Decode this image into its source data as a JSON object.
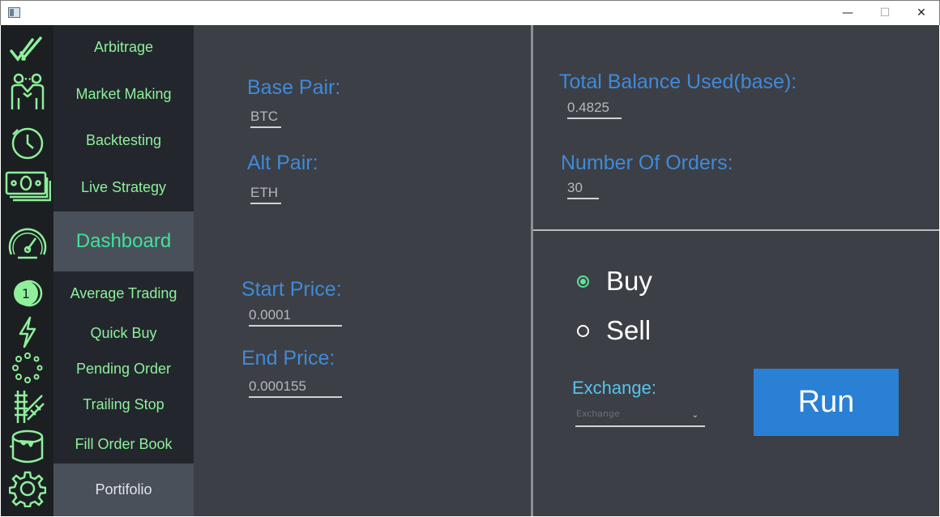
{
  "window": {
    "minimize_glyph": "—",
    "maximize_glyph": "☐",
    "close_glyph": "✕"
  },
  "icon_sidebar": {
    "icons": [
      "checkmark-icon",
      "handshake-icon",
      "clock-icon",
      "money-icon",
      "speedometer-icon",
      "coin-icon",
      "lightning-icon",
      "loading-dots-icon",
      "railway-icon",
      "paint-bucket-icon",
      "gear-icon"
    ],
    "coin_number": "1",
    "accent_color": "#8ef09b"
  },
  "menu": {
    "items": [
      "Arbitrage",
      "Market Making",
      "Backtesting",
      "Live Strategy"
    ],
    "active": "Dashboard",
    "sub_items": [
      "Average Trading",
      "Quick Buy",
      "Pending Order",
      "Trailing Stop",
      "Fill Order Book"
    ],
    "footer": "Portifolio"
  },
  "form": {
    "base_pair_label": "Base Pair:",
    "base_pair_value": "BTC",
    "alt_pair_label": "Alt Pair:",
    "alt_pair_value": "ETH",
    "start_price_label": "Start Price:",
    "start_price_value": "0.0001",
    "end_price_label": "End Price:",
    "end_price_value": "0.000155",
    "total_balance_label": "Total Balance Used(base):",
    "total_balance_value": "0.4825",
    "orders_label": "Number Of Orders:",
    "orders_value": "30"
  },
  "side": {
    "buy_label": "Buy",
    "sell_label": "Sell",
    "selected": "Buy"
  },
  "exchange": {
    "label": "Exchange:",
    "placeholder": "Exchange"
  },
  "run_label": "Run",
  "colors": {
    "label_blue": "#3f8ad9",
    "run_button": "#2a80d5",
    "background": "#3c3f45",
    "menu_bg": "#23272d"
  }
}
